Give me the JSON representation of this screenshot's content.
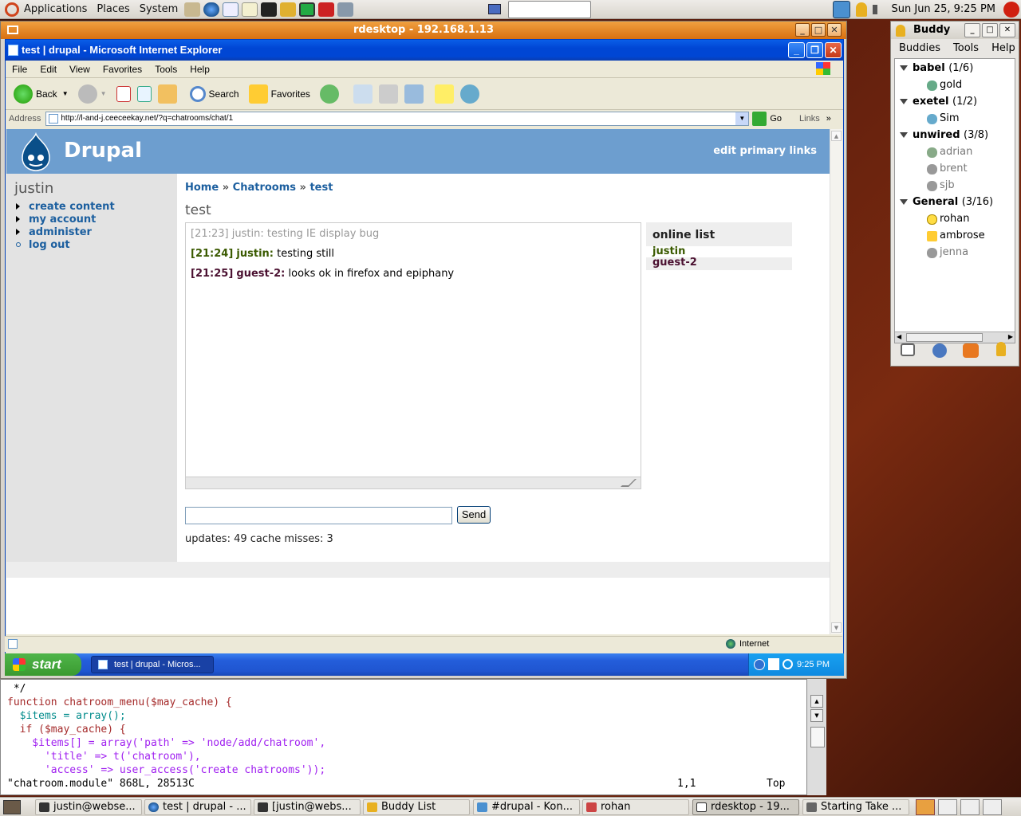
{
  "top_panel": {
    "menus": [
      "Applications",
      "Places",
      "System"
    ],
    "clock": "Sun Jun 25,  9:25 PM"
  },
  "rdesktop": {
    "title": "rdesktop - 192.168.1.13"
  },
  "ie": {
    "title": "test  |  drupal - Microsoft Internet Explorer",
    "menu": [
      "File",
      "Edit",
      "View",
      "Favorites",
      "Tools",
      "Help"
    ],
    "toolbar": {
      "back": "Back",
      "search": "Search",
      "favorites": "Favorites"
    },
    "address_label": "Address",
    "address_value": "http://l-and-j.ceeceekay.net/?q=chatrooms/chat/1",
    "go": "Go",
    "links": "Links",
    "status_zone": "Internet"
  },
  "drupal": {
    "site_name": "Drupal",
    "primary_links": "edit primary links",
    "user": "justin",
    "nav": [
      "create content",
      "my account",
      "administer",
      "log out"
    ],
    "breadcrumb": [
      "Home",
      "Chatrooms",
      "test"
    ],
    "breadcrumb_sep": "»",
    "page_title": "test",
    "messages": [
      {
        "time": "[21:23]",
        "user": "justin:",
        "text": "testing IE display bug",
        "style": "old"
      },
      {
        "time": "[21:24]",
        "user": "justin:",
        "text": "testing still",
        "style": "self",
        "color": "#3a5a00"
      },
      {
        "time": "[21:25]",
        "user": "guest-2:",
        "text": "looks ok in firefox and epiphany",
        "style": "other",
        "color": "#4a1030"
      }
    ],
    "online_title": "online list",
    "online_users": [
      {
        "name": "justin",
        "color": "#3a5a00"
      },
      {
        "name": "guest-2",
        "color": "#4a1030"
      }
    ],
    "send": "Send",
    "stats": "updates: 49 cache misses: 3"
  },
  "xp_taskbar": {
    "start": "start",
    "item": "test | drupal - Micros...",
    "time": "9:25 PM"
  },
  "vim": {
    "lines": [
      " */",
      "function chatroom_menu($may_cache) {",
      "  $items = array();",
      "  if ($may_cache) {",
      "    $items[] = array('path' => 'node/add/chatroom',",
      "      'title' => t('chatroom'),",
      "      'access' => user_access('create chatrooms'));"
    ],
    "status_file": "\"chatroom.module\" 868L, 28513C",
    "status_pos": "1,1",
    "status_top": "Top"
  },
  "buddy": {
    "title": "Buddy",
    "menu": [
      "Buddies",
      "Tools",
      "Help"
    ],
    "groups": [
      {
        "name": "babel",
        "count": "(1/6)",
        "buddies": [
          "gold"
        ]
      },
      {
        "name": "exetel",
        "count": "(1/2)",
        "buddies": [
          "Sim"
        ]
      },
      {
        "name": "unwired",
        "count": "(3/8)",
        "buddies": [
          "adrian",
          "brent",
          "sjb"
        ]
      },
      {
        "name": "General",
        "count": "(3/16)",
        "buddies": [
          "rohan",
          "ambrose",
          "jenna"
        ]
      }
    ]
  },
  "bottom_panel": {
    "items": [
      "justin@webse...",
      "test | drupal - ...",
      "[justin@webs...",
      "Buddy List",
      "#drupal - Kon...",
      "rohan",
      "rdesktop - 19...",
      "Starting Take ..."
    ]
  }
}
